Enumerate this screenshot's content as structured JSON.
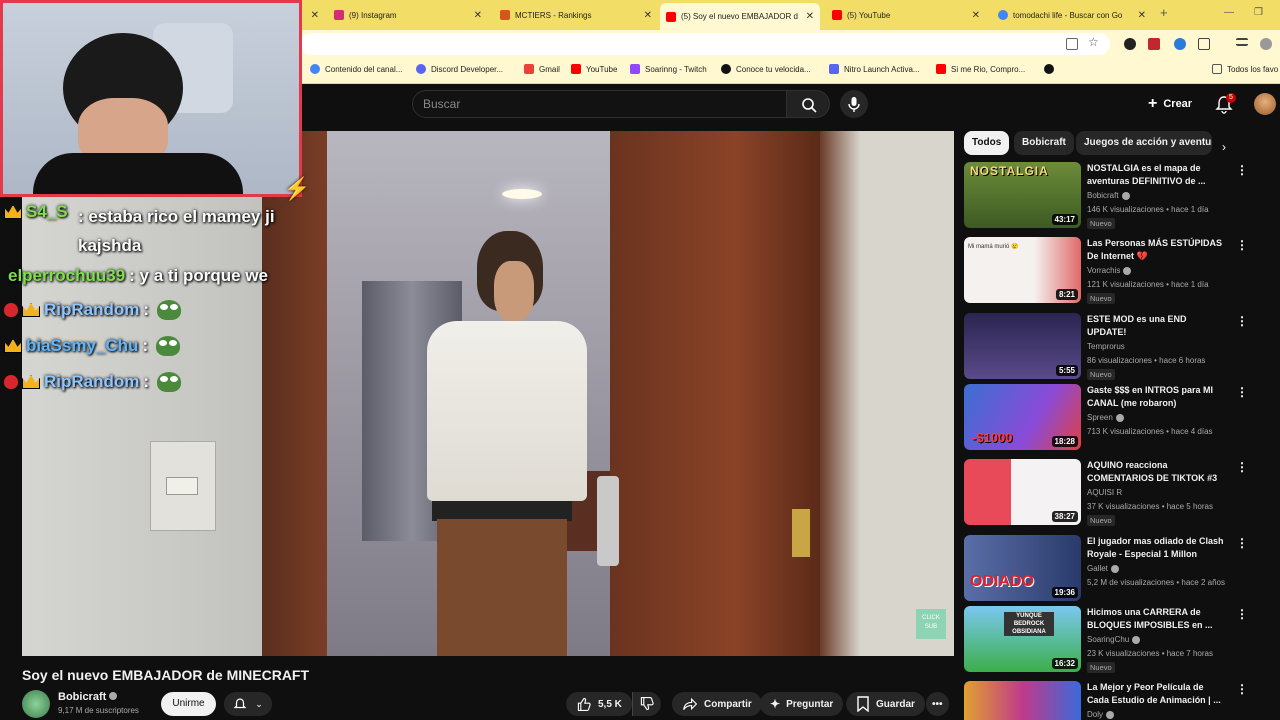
{
  "browser": {
    "tabs": [
      {
        "label": "(9) Instagram",
        "color": "#d62976"
      },
      {
        "label": "MCTIERS - Rankings",
        "color": "#d9531e"
      },
      {
        "label": "(5) Soy el nuevo EMBAJADOR d",
        "color": "#ff0000",
        "active": true
      },
      {
        "label": "(5) YouTube",
        "color": "#ff0000"
      },
      {
        "label": "tomodachi life - Buscar con Go",
        "color": "#4285f4"
      }
    ],
    "new_tab": "+",
    "bookmarks": [
      {
        "label": "Contenido del canal...",
        "color": "#4285f4"
      },
      {
        "label": "Discord Developer...",
        "color": "#5865f2"
      },
      {
        "label": "Gmail",
        "color": "#ea4335"
      },
      {
        "label": "YouTube",
        "color": "#ff0000"
      },
      {
        "label": "Soarinng - Twitch",
        "color": "#9146ff"
      },
      {
        "label": "Conoce tu velocida...",
        "color": "#111111"
      },
      {
        "label": "Nitro Launch Activa...",
        "color": "#5865f2"
      },
      {
        "label": "Si me Rio, Compro...",
        "color": "#ff0000"
      },
      {
        "label": "Todos los favo",
        "color": "#777777"
      }
    ]
  },
  "youtube": {
    "search_placeholder": "Buscar",
    "create_label": "Crear",
    "notif_count": "5",
    "video": {
      "title": "Soy el nuevo EMBAJADOR de MINECRAFT",
      "channel": "Bobicraft",
      "subscribers": "9,17 M de suscriptores",
      "join_label": "Unirme",
      "likes": "5,5 K",
      "share_label": "Compartir",
      "ask_label": "Preguntar",
      "save_label": "Guardar",
      "more_label": "•••",
      "watermark": "CLICK SUB"
    },
    "chips": [
      "Todos",
      "Bobicraft",
      "Juegos de acción y aventura"
    ],
    "recommendations": [
      {
        "title": "NOSTALGIA es el mapa de aventuras DEFINITIVO de ...",
        "channel": "Bobicraft",
        "verified": true,
        "meta": "146 K visualizaciones • hace 1 día",
        "badge": "Nuevo",
        "duration": "43:17",
        "thumb_text": "NOSTALGIA"
      },
      {
        "title": "Las Personas MÁS ESTÚPIDAS De Internet 💔",
        "channel": "Vorrachis",
        "verified": true,
        "meta": "121 K visualizaciones • hace 1 día",
        "badge": "Nuevo",
        "duration": "8:21",
        "thumb_text": "Mi mamá murió 😢"
      },
      {
        "title": "ESTE MOD es una END UPDATE!",
        "channel": "Temprorus",
        "verified": false,
        "meta": "86 visualizaciones • hace 6 horas",
        "badge": "Nuevo",
        "duration": "5:55",
        "thumb_text": ""
      },
      {
        "title": "Gaste $$$ en INTROS para MI CANAL (me robaron)",
        "channel": "Spreen",
        "verified": true,
        "meta": "713 K visualizaciones • hace 4 días",
        "badge": "",
        "duration": "18:28",
        "thumb_text": "-$1000"
      },
      {
        "title": "AQUINO reacciona COMENTARIOS DE TIKTOK #3",
        "channel": "AQUISI R",
        "verified": false,
        "meta": "37 K visualizaciones • hace 5 horas",
        "badge": "Nuevo",
        "duration": "38:27",
        "thumb_text": ""
      },
      {
        "title": "El jugador mas odiado de Clash Royale - Especial 1 Millon",
        "channel": "Gallet",
        "verified": true,
        "meta": "5,2 M de visualizaciones • hace 2 años",
        "badge": "",
        "duration": "19:36",
        "thumb_text": "ODIADO"
      },
      {
        "title": "Hicimos una CARRERA de BLOQUES IMPOSIBLES en ...",
        "channel": "SoaringChu",
        "verified": true,
        "meta": "23 K visualizaciones • hace 7 horas",
        "badge": "Nuevo",
        "duration": "16:32",
        "thumb_text": "YUNQUE BEDROCK OBSIDIANA"
      },
      {
        "title": "La Mejor y Peor Película de Cada Estudio de Animación | ...",
        "channel": "Doly",
        "verified": true,
        "meta": "",
        "badge": "",
        "duration": "",
        "thumb_text": ""
      }
    ]
  },
  "stream_chat": [
    {
      "user": "S4_S",
      "user_color": "#7ee04a",
      "message": ": estaba rico el mamey ji kajshda",
      "badges": [
        "crown"
      ]
    },
    {
      "user": "elperrochuu39",
      "user_color": "#7ee04a",
      "message": ": y a ti porque we",
      "badges": []
    },
    {
      "user": "RipRandom",
      "user_color": "#8fc6ff",
      "message": ":",
      "badges": [
        "berry",
        "crown"
      ],
      "emote": "pepe"
    },
    {
      "user": "biaSsmy_Chu",
      "user_color": "#5fb6ff",
      "message": ":",
      "badges": [
        "crown"
      ],
      "emote": "pepe"
    },
    {
      "user": "RipRandom",
      "user_color": "#8fc6ff",
      "message": ":",
      "badges": [
        "berry",
        "crown"
      ],
      "emote": "pepe"
    }
  ]
}
